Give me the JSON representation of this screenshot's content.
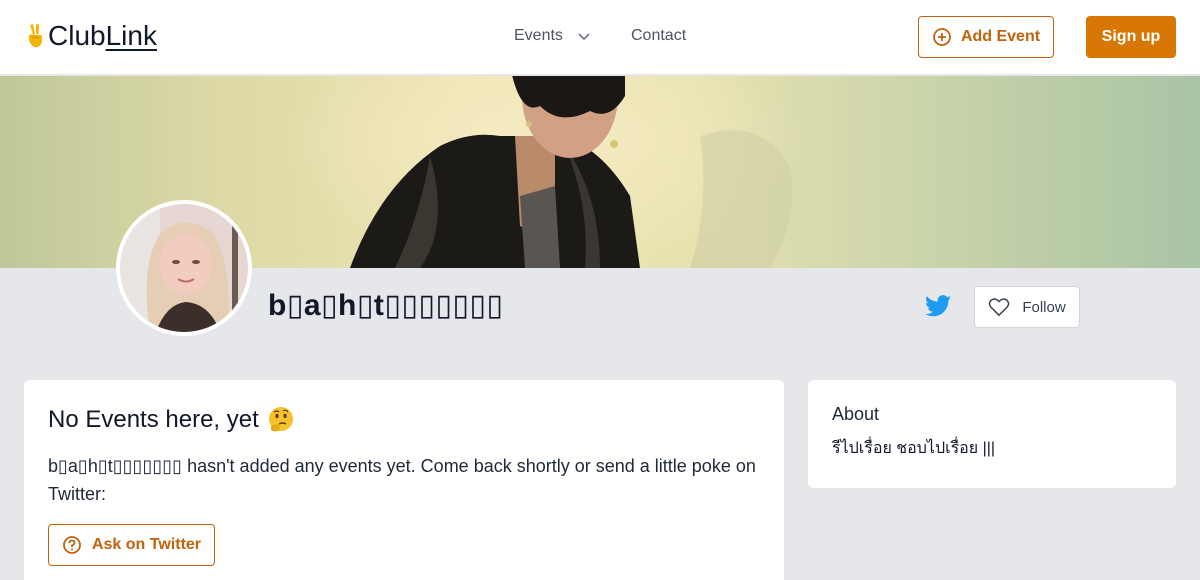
{
  "header": {
    "logo_prefix": "Club",
    "logo_link": "Link",
    "nav_events": "Events",
    "nav_contact": "Contact",
    "add_event": "Add Event",
    "sign_up": "Sign up"
  },
  "profile": {
    "name": "b▯a▯h▯t▯▯▯▯▯▯▯",
    "follow": "Follow"
  },
  "main": {
    "title": "No Events here, yet",
    "message": "b▯a▯h▯t▯▯▯▯▯▯▯ hasn't added any events yet. Come back shortly or send a little poke on Twitter:",
    "ask_twitter": "Ask on Twitter"
  },
  "about": {
    "title": "About",
    "text": "รีไปเรื่อย ชอบไปเรื่อย |||"
  },
  "colors": {
    "accent": "#d97706",
    "accent_dark": "#c2620a",
    "twitter": "#1d9bf0",
    "page_bg": "#e5e7eb"
  },
  "icons": {
    "logo": "victory-hand-icon",
    "events_caret": "chevron-down-icon",
    "add_event": "plus-circle-icon",
    "twitter": "twitter-bird-icon",
    "follow": "heart-outline-icon",
    "thinking": "thinking-face-icon",
    "ask": "question-circle-icon"
  }
}
